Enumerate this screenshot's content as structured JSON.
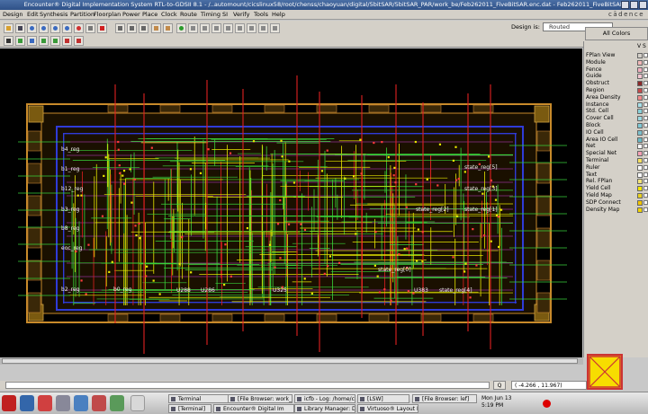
{
  "window": {
    "title": "Encounter® Digital Implementation System RTL-to-GDSII 8.1 - /..automount/cicslinux58/root/chenss/chaoyuan/digital/5bitSAR/5bitSAR_PAR/work_be/Feb262011_FiveBitSAR.enc.dat - Feb262011_FiveBitSAR"
  },
  "menu": {
    "items": [
      "Design",
      "Edit",
      "Synthesis",
      "Partition",
      "Floorplan",
      "Power",
      "Place",
      "Clock",
      "Route",
      "Timing",
      "SI",
      "Verify",
      "Tools",
      "Help"
    ],
    "brand": "cādence"
  },
  "toolbar": {
    "design_is_label": "Design is:",
    "design_status": "Routed",
    "all_colors_label": "All Colors"
  },
  "layers": {
    "header_v": "V",
    "header_s": "S",
    "items": [
      {
        "label": "FPlan View",
        "color": "#d4d0c8"
      },
      {
        "label": "Module",
        "color": "#f0b8b8"
      },
      {
        "label": "Fence",
        "color": "#f2b0c0"
      },
      {
        "label": "Guide",
        "color": "#f4c6d2"
      },
      {
        "label": "Obstruct",
        "color": "#8b2a2a"
      },
      {
        "label": "Region",
        "color": "#c24a4a"
      },
      {
        "label": "Area Density",
        "color": "#f28a8a"
      },
      {
        "label": "Instance",
        "color": "#a8e0e8"
      },
      {
        "label": "Std. Cell",
        "color": "#8ad0d8"
      },
      {
        "label": "Cover Cell",
        "color": "#9cd8e0"
      },
      {
        "label": "Block",
        "color": "#80c8d4"
      },
      {
        "label": "IO Cell",
        "color": "#7cc0cc"
      },
      {
        "label": "Area IO Cell",
        "color": "#6ab8c4"
      },
      {
        "label": "Net",
        "color": "#ffffff"
      },
      {
        "label": "Special Net",
        "color": "#f4a0b4"
      },
      {
        "label": "Terminal",
        "color": "#f6e060"
      },
      {
        "label": "Ruler",
        "color": "#ffffff"
      },
      {
        "label": "Text",
        "color": "#ffffff"
      },
      {
        "label": "Rel. FPlan",
        "color": "#f3e37a"
      },
      {
        "label": "Yield Cell",
        "color": "#f4e600"
      },
      {
        "label": "Yield Map",
        "color": "#e8d020"
      },
      {
        "label": "SDP Connect",
        "color": "#f2c400"
      },
      {
        "label": "Density Map",
        "color": "#f2d400"
      }
    ]
  },
  "canvas": {
    "labels": {
      "b4_reg": "b4_reg",
      "b1_reg": "b1_reg",
      "b12_reg": "b12_reg",
      "b3_reg": "b3_reg",
      "b8_reg": "b8_reg",
      "eoc_reg": "eoc_reg",
      "b2_reg": "b2_reg",
      "b0_reg": "b0_reg",
      "u288": "U288",
      "u286": "U286",
      "u325": "U325",
      "u383": "U383",
      "state_reg5": "state_reg[5]",
      "state_reg3": "state_reg[3]",
      "state_reg2": "state_reg[2]",
      "state_reg1": "state_reg[1]",
      "state_reg0": "state_reg[0]",
      "state_reg4": "state_reg[4]"
    }
  },
  "status": {
    "q_button": "Q",
    "coords": "( -4.266 , 11.967)"
  },
  "taskbar": {
    "tasks": [
      "Terminal",
      "[File Browser: work_b",
      "icfb - Log: /home/cyp",
      "[LSW]",
      "[File Browser: lef]",
      "[Terminal]",
      "Encounter® Digital Im",
      "Library Manager: Direc",
      "Virtuoso® Layout Edit"
    ],
    "clock_day": "Mon Jun 13",
    "clock_time": "5:19 PM"
  },
  "colors": {
    "canvas_bg": "#000000",
    "route_green": "#39d23a",
    "route_yellow": "#e6e600",
    "route_red": "#e02020",
    "route_blue": "#2f3bd8",
    "route_magenta": "#c83fd8",
    "io_orange": "#c88a2a"
  }
}
